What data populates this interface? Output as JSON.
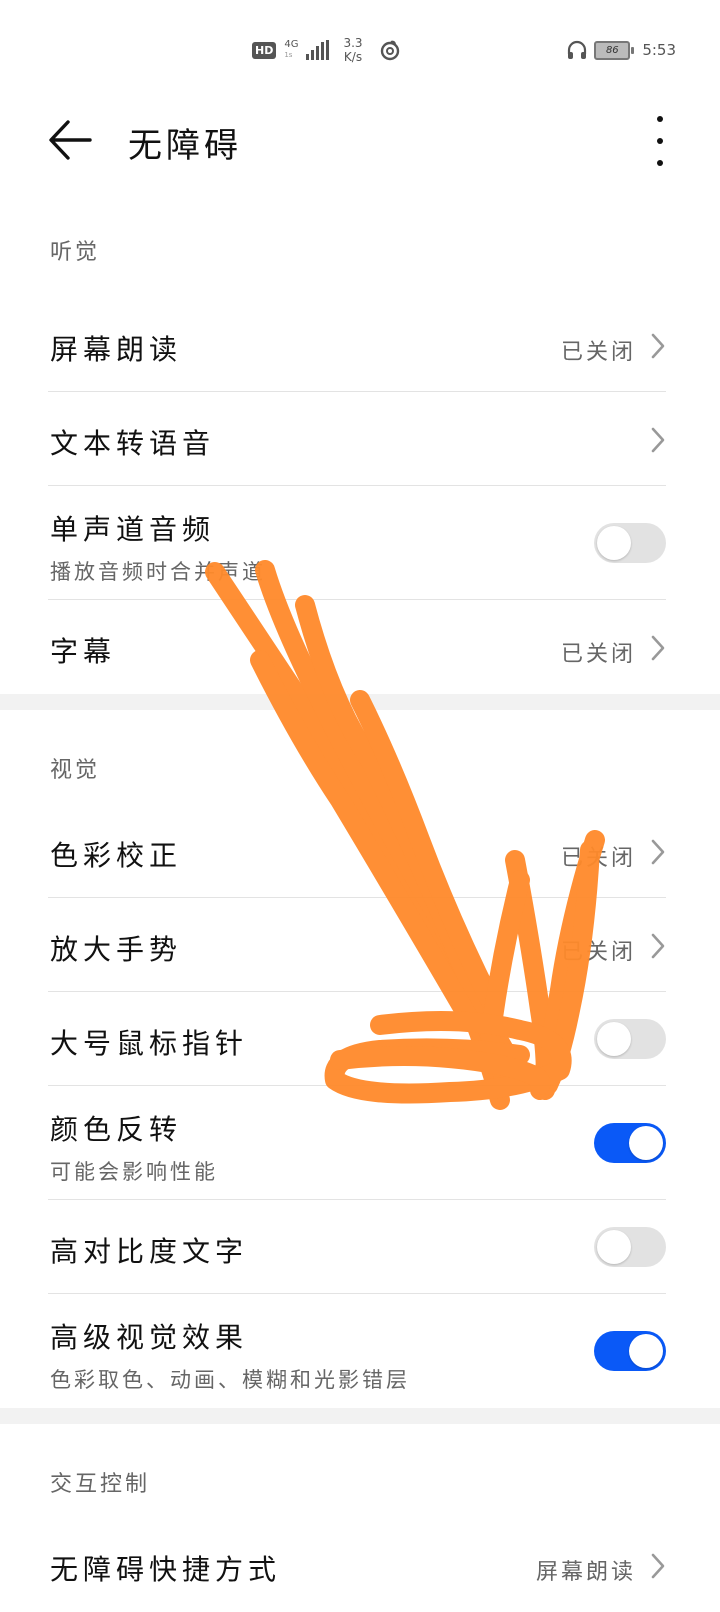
{
  "status_bar": {
    "hd": "HD",
    "network": "4G",
    "network_sub": "1s",
    "speed_value": "3.3",
    "speed_unit": "K/s",
    "battery": "86",
    "time": "5:53"
  },
  "app_bar": {
    "title": "无障碍"
  },
  "sections": {
    "hearing": {
      "header": "听觉",
      "screen_reader": {
        "label": "屏幕朗读",
        "value": "已关闭"
      },
      "tts": {
        "label": "文本转语音"
      },
      "mono_audio": {
        "label": "单声道音频",
        "sub": "播放音频时合并声道",
        "on": false
      },
      "captions": {
        "label": "字幕",
        "value": "已关闭"
      }
    },
    "vision": {
      "header": "视觉",
      "color_correction": {
        "label": "色彩校正",
        "value": "已关闭"
      },
      "magnification": {
        "label": "放大手势",
        "value": "已关闭"
      },
      "large_pointer": {
        "label": "大号鼠标指针",
        "on": false
      },
      "color_inversion": {
        "label": "颜色反转",
        "sub": "可能会影响性能",
        "on": true
      },
      "high_contrast_text": {
        "label": "高对比度文字",
        "on": false
      },
      "advanced_visual": {
        "label": "高级视觉效果",
        "sub": "色彩取色、动画、模糊和光影错层",
        "on": true
      }
    },
    "interaction": {
      "header": "交互控制",
      "shortcut": {
        "label": "无障碍快捷方式",
        "value": "屏幕朗读"
      }
    }
  },
  "colors": {
    "accent": "#0a59f7",
    "scribble": "#ff8a2b"
  }
}
